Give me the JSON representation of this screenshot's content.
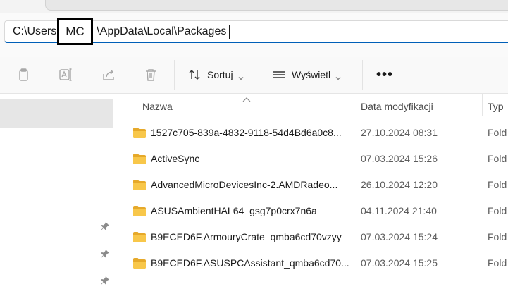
{
  "address_bar": {
    "path": "C:\\Users\\MC\\AppData\\Local\\Packages",
    "before_redaction": "C:\\Users",
    "redacted_segment": "MC",
    "after_redaction": "\\AppData\\Local\\Packages"
  },
  "toolbar": {
    "sort_label": "Sortuj",
    "view_label": "Wyświetl",
    "more_label": "•••",
    "disabled_actions": [
      "copy-icon",
      "rename-icon",
      "share-icon",
      "delete-icon"
    ]
  },
  "columns": {
    "name": "Nazwa",
    "date": "Data modyfikacji",
    "type": "Typ"
  },
  "rows": [
    {
      "name": "1527c705-839a-4832-9118-54d4Bd6a0c8...",
      "date": "27.10.2024 08:31",
      "type": "Fold"
    },
    {
      "name": "ActiveSync",
      "date": "07.03.2024 15:26",
      "type": "Fold"
    },
    {
      "name": "AdvancedMicroDevicesInc-2.AMDRadeo...",
      "date": "26.10.2024 12:20",
      "type": "Fold"
    },
    {
      "name": "ASUSAmbientHAL64_gsg7p0crx7n6a",
      "date": "04.11.2024 21:40",
      "type": "Fold"
    },
    {
      "name": "B9ECED6F.ArmouryCrate_qmba6cd70vzyy",
      "date": "07.03.2024 15:24",
      "type": "Fold"
    },
    {
      "name": "B9ECED6F.ASUSPCAssistant_qmba6cd70...",
      "date": "07.03.2024 15:25",
      "type": "Fold"
    }
  ],
  "colors": {
    "accent": "#005fb8",
    "folder": "#f8c74a",
    "selection": "#e6e6e6"
  }
}
